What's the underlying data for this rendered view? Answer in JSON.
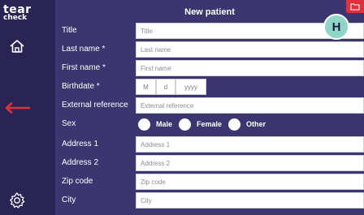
{
  "app": {
    "logo_line1": "tear",
    "logo_line2": "check"
  },
  "header": {
    "title": "New patient",
    "help_label": "H"
  },
  "sidebar": {
    "icons": [
      "home-icon",
      "back-arrow-icon",
      "settings-gear-icon"
    ]
  },
  "form": {
    "title_label": "Title",
    "title_placeholder": "Title",
    "last_name_label": "Last name *",
    "last_name_placeholder": "Last name",
    "first_name_label": "First name *",
    "first_name_placeholder": "First name",
    "birthdate_label": "Birthdate *",
    "birth_month": "M",
    "birth_day": "d",
    "birth_year": "yyyy",
    "external_ref_label": "External reference",
    "external_ref_placeholder": "External reference",
    "sex_label": "Sex",
    "sex_options": [
      "Male",
      "Female",
      "Other"
    ],
    "address1_label": "Address 1",
    "address1_placeholder": "Address 1",
    "address2_label": "Address 2",
    "address2_placeholder": "Address 2",
    "zip_label": "Zip code",
    "zip_placeholder": "Zip code",
    "city_label": "City",
    "city_placeholder": "City"
  },
  "colors": {
    "sidebar_bg": "#2a2454",
    "panel_bg": "#3b3670",
    "accent_red": "#e0303b",
    "help_bg": "#8fd6c6"
  }
}
